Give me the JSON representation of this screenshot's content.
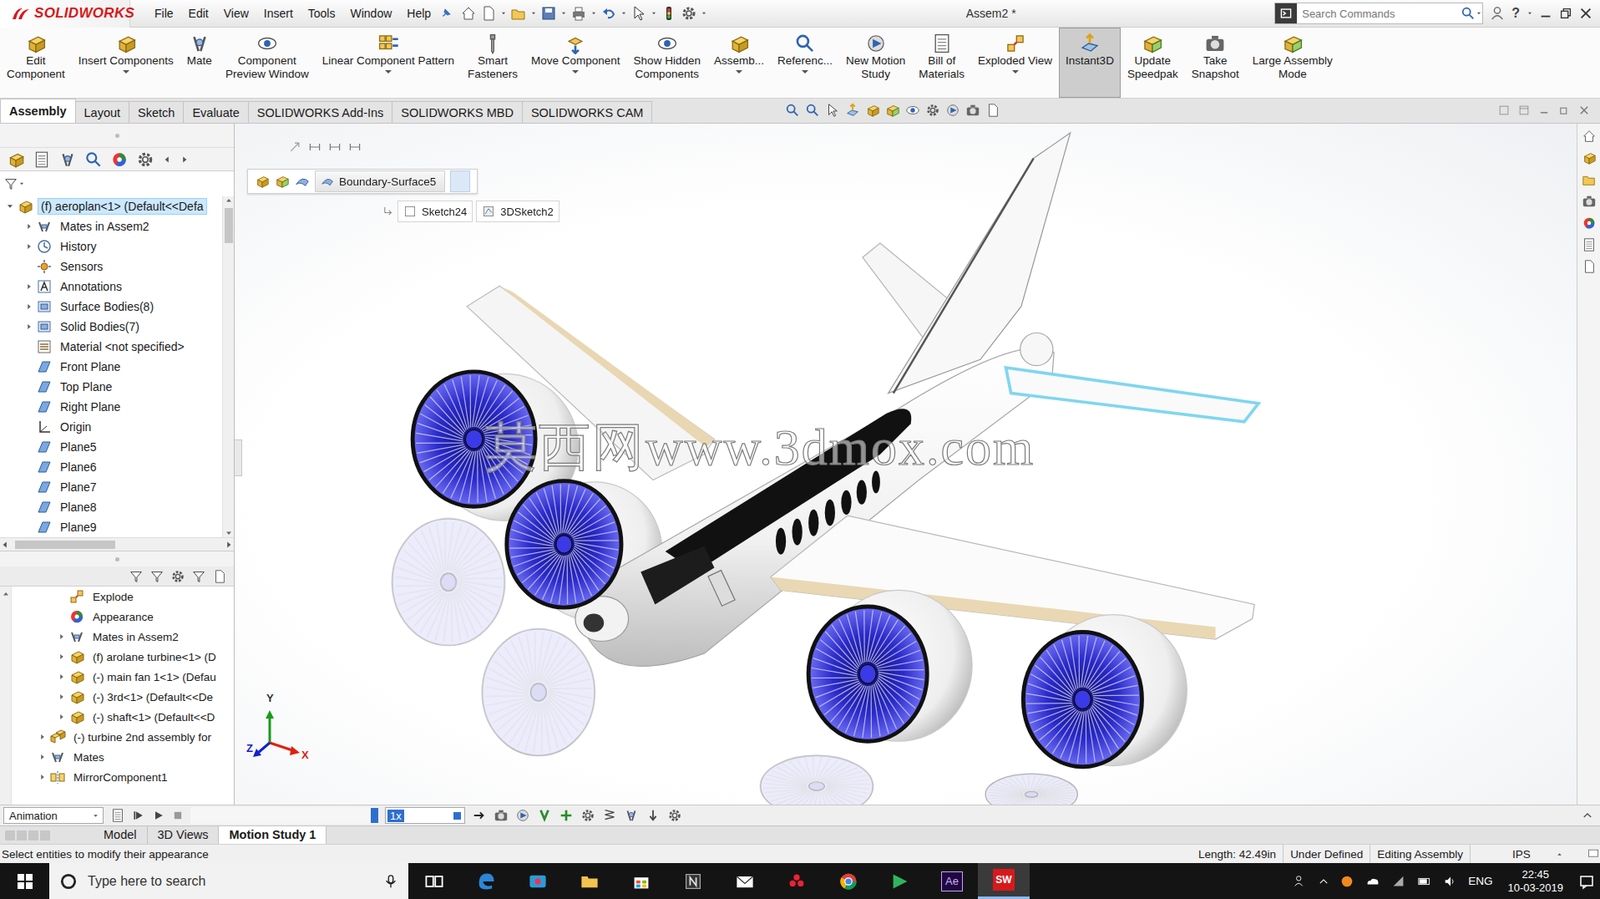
{
  "window": {
    "app": "SOLIDWORKS",
    "title": "Assem2 *",
    "help": "?"
  },
  "menu": [
    "File",
    "Edit",
    "View",
    "Insert",
    "Tools",
    "Window",
    "Help"
  ],
  "search": {
    "placeholder": "Search Commands"
  },
  "ribbon": [
    {
      "lines": [
        "Edit",
        "Component"
      ],
      "dropdown": false,
      "selected": false
    },
    {
      "lines": [
        "Insert Components"
      ],
      "dropdown": true,
      "selected": false
    },
    {
      "lines": [
        "Mate"
      ],
      "dropdown": false,
      "selected": false
    },
    {
      "lines": [
        "Component",
        "Preview Window"
      ],
      "dropdown": false,
      "selected": false
    },
    {
      "lines": [
        "Linear Component Pattern"
      ],
      "dropdown": true,
      "selected": false
    },
    {
      "lines": [
        "Smart",
        "Fasteners"
      ],
      "dropdown": false,
      "selected": false
    },
    {
      "lines": [
        "Move Component"
      ],
      "dropdown": true,
      "selected": false
    },
    {
      "lines": [
        "Show Hidden",
        "Components"
      ],
      "dropdown": false,
      "selected": false
    },
    {
      "lines": [
        "Assemb..."
      ],
      "dropdown": true,
      "selected": false
    },
    {
      "lines": [
        "Referenc..."
      ],
      "dropdown": true,
      "selected": false
    },
    {
      "lines": [
        "New Motion",
        "Study"
      ],
      "dropdown": false,
      "selected": false
    },
    {
      "lines": [
        "Bill of",
        "Materials"
      ],
      "dropdown": false,
      "selected": false
    },
    {
      "lines": [
        "Exploded View"
      ],
      "dropdown": true,
      "selected": false
    },
    {
      "lines": [
        "Instant3D"
      ],
      "dropdown": false,
      "selected": true
    },
    {
      "lines": [
        "Update",
        "Speedpak"
      ],
      "dropdown": false,
      "selected": false
    },
    {
      "lines": [
        "Take",
        "Snapshot"
      ],
      "dropdown": false,
      "selected": false
    },
    {
      "lines": [
        "Large Assembly",
        "Mode"
      ],
      "dropdown": false,
      "selected": false
    }
  ],
  "command_tabs": [
    {
      "label": "Assembly",
      "selected": true
    },
    {
      "label": "Layout",
      "selected": false
    },
    {
      "label": "Sketch",
      "selected": false
    },
    {
      "label": "Evaluate",
      "selected": false
    },
    {
      "label": "SOLIDWORKS Add-Ins",
      "selected": false
    },
    {
      "label": "SOLIDWORKS MBD",
      "selected": false
    },
    {
      "label": "SOLIDWORKS CAM",
      "selected": false
    }
  ],
  "feature_tree": {
    "items": [
      {
        "label": "(f) aeroplan<1> (Default<<Defa",
        "kind": "part",
        "depth": 0,
        "expandable": true,
        "expanded": true,
        "selected": true
      },
      {
        "label": "Mates in Assem2",
        "kind": "mates",
        "depth": 1,
        "expandable": true,
        "expanded": false,
        "selected": false
      },
      {
        "label": "History",
        "kind": "history",
        "depth": 1,
        "expandable": true,
        "expanded": false,
        "selected": false
      },
      {
        "label": "Sensors",
        "kind": "sensor",
        "depth": 1,
        "expandable": false,
        "expanded": false,
        "selected": false
      },
      {
        "label": "Annotations",
        "kind": "annotation",
        "depth": 1,
        "expandable": true,
        "expanded": false,
        "selected": false
      },
      {
        "label": "Surface Bodies(8)",
        "kind": "bodies",
        "depth": 1,
        "expandable": true,
        "expanded": false,
        "selected": false
      },
      {
        "label": "Solid Bodies(7)",
        "kind": "bodies",
        "depth": 1,
        "expandable": true,
        "expanded": false,
        "selected": false
      },
      {
        "label": "Material <not specified>",
        "kind": "material",
        "depth": 1,
        "expandable": false,
        "expanded": false,
        "selected": false
      },
      {
        "label": "Front Plane",
        "kind": "plane",
        "depth": 1,
        "expandable": false,
        "expanded": false,
        "selected": false
      },
      {
        "label": "Top Plane",
        "kind": "plane",
        "depth": 1,
        "expandable": false,
        "expanded": false,
        "selected": false
      },
      {
        "label": "Right Plane",
        "kind": "plane",
        "depth": 1,
        "expandable": false,
        "expanded": false,
        "selected": false
      },
      {
        "label": "Origin",
        "kind": "origin",
        "depth": 1,
        "expandable": false,
        "expanded": false,
        "selected": false
      },
      {
        "label": "Plane5",
        "kind": "plane",
        "depth": 1,
        "expandable": false,
        "expanded": false,
        "selected": false
      },
      {
        "label": "Plane6",
        "kind": "plane",
        "depth": 1,
        "expandable": false,
        "expanded": false,
        "selected": false
      },
      {
        "label": "Plane7",
        "kind": "plane",
        "depth": 1,
        "expandable": false,
        "expanded": false,
        "selected": false
      },
      {
        "label": "Plane8",
        "kind": "plane",
        "depth": 1,
        "expandable": false,
        "expanded": false,
        "selected": false
      },
      {
        "label": "Plane9",
        "kind": "plane",
        "depth": 1,
        "expandable": false,
        "expanded": false,
        "selected": false
      }
    ]
  },
  "motion_tree": {
    "items": [
      {
        "label": "Explode",
        "kind": "explode",
        "depth": 2,
        "expandable": false,
        "expanded": false,
        "selected": false
      },
      {
        "label": "Appearance",
        "kind": "appearance",
        "depth": 2,
        "expandable": false,
        "expanded": false,
        "selected": false
      },
      {
        "label": "Mates in Assem2",
        "kind": "mates",
        "depth": 2,
        "expandable": true,
        "expanded": false,
        "selected": false
      },
      {
        "label": "(f) arolane turbine<1> (D",
        "kind": "part",
        "depth": 2,
        "expandable": true,
        "expanded": false,
        "selected": false
      },
      {
        "label": "(-) main fan 1<1> (Defau",
        "kind": "part",
        "depth": 2,
        "expandable": true,
        "expanded": false,
        "selected": false
      },
      {
        "label": "(-) 3rd<1> (Default<<De",
        "kind": "part",
        "depth": 2,
        "expandable": true,
        "expanded": false,
        "selected": false
      },
      {
        "label": "(-) shaft<1> (Default<<D",
        "kind": "part",
        "depth": 2,
        "expandable": true,
        "expanded": false,
        "selected": false
      },
      {
        "label": "(-) turbine 2nd assembly for",
        "kind": "assembly",
        "depth": 1,
        "expandable": true,
        "expanded": false,
        "selected": false
      },
      {
        "label": "Mates",
        "kind": "mates",
        "depth": 1,
        "expandable": true,
        "expanded": false,
        "selected": false
      },
      {
        "label": "MirrorComponent1",
        "kind": "mirror",
        "depth": 1,
        "expandable": true,
        "expanded": false,
        "selected": false
      }
    ]
  },
  "breadcrumb": {
    "feature": "Boundary-Surface5",
    "children": [
      "Sketch24",
      "3DSketch2"
    ]
  },
  "watermark": "莫西网www.3dmox.com",
  "triad": {
    "x": "X",
    "y": "Y",
    "z": "Z"
  },
  "motion_bar": {
    "study_type": "Animation",
    "speed": "1x"
  },
  "bottom_tabs": [
    {
      "label": "Model",
      "selected": false
    },
    {
      "label": "3D Views",
      "selected": false
    },
    {
      "label": "Motion Study 1",
      "selected": true
    }
  ],
  "status_bar": {
    "message": "Select entities to modify their appearance",
    "length": "Length: 42.49in",
    "sketch_state": "Under Defined",
    "mode": "Editing Assembly",
    "units": "IPS"
  },
  "taskbar": {
    "search_placeholder": "Type here to search",
    "ae_label": "Ae",
    "sw_label": "SW",
    "language": "ENG",
    "time": "22:45",
    "date": "10-03-2019"
  }
}
